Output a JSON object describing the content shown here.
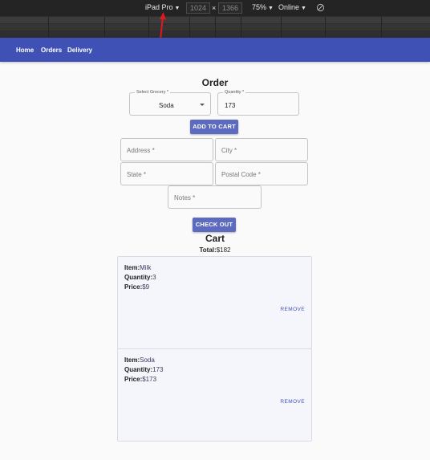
{
  "devtools": {
    "device": "iPad Pro",
    "width": "1024",
    "dim_separator": "×",
    "height": "1366",
    "zoom": "75%",
    "network": "Online",
    "caret": "▼"
  },
  "nav": {
    "home": "Home",
    "orders": "Orders",
    "delivery": "Delivery"
  },
  "order": {
    "title": "Order",
    "grocery_label": "Select Grocery *",
    "grocery_value": "Soda",
    "quantity_label": "Quantity *",
    "quantity_value": "173",
    "add_to_cart": "ADD TO CART",
    "address_placeholder": "Address *",
    "city_placeholder": "City *",
    "state_placeholder": "State *",
    "postal_placeholder": "Postal Code *",
    "notes_placeholder": "Notes *",
    "checkout": "CHECK OUT"
  },
  "cart": {
    "title": "Cart",
    "total_label": "Total:",
    "total_value": "$182",
    "item_label": "Item:",
    "quantity_label": "Quantity:",
    "price_label": "Price:",
    "remove_label": "REMOVE",
    "items": [
      {
        "item": "Milk",
        "quantity": "3",
        "price": "$9"
      },
      {
        "item": "Soda",
        "quantity": "173",
        "price": "$173"
      }
    ]
  },
  "colors": {
    "appbar": "#3f51b5",
    "button": "#5c6bc0",
    "annotation": "#e0191e"
  }
}
